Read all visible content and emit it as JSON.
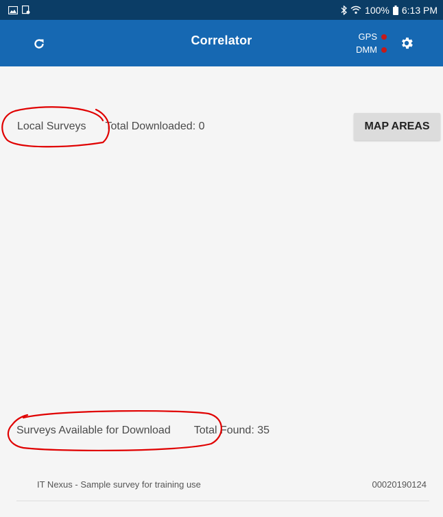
{
  "status_bar": {
    "left_icons": [
      "gallery-icon",
      "notification-icon"
    ],
    "right_icons": [
      "bluetooth-icon",
      "wifi-icon"
    ],
    "battery": "100%",
    "time": "6:13 PM"
  },
  "app_bar": {
    "title": "Correlator",
    "gps_label": "GPS",
    "dmm_label": "DMM",
    "indicator_color": "#c41a1a",
    "background": "#1668b2"
  },
  "local_surveys": {
    "title": "Local Surveys",
    "total_label": "Total Downloaded: 0",
    "map_areas_button": "MAP AREAS"
  },
  "available_surveys": {
    "title": "Surveys Available for Download",
    "total_label": "Total Found: 35",
    "items": [
      {
        "name": "IT Nexus - Sample survey for training use",
        "id": "00020190124"
      }
    ]
  },
  "annotation_color": "#e00000"
}
